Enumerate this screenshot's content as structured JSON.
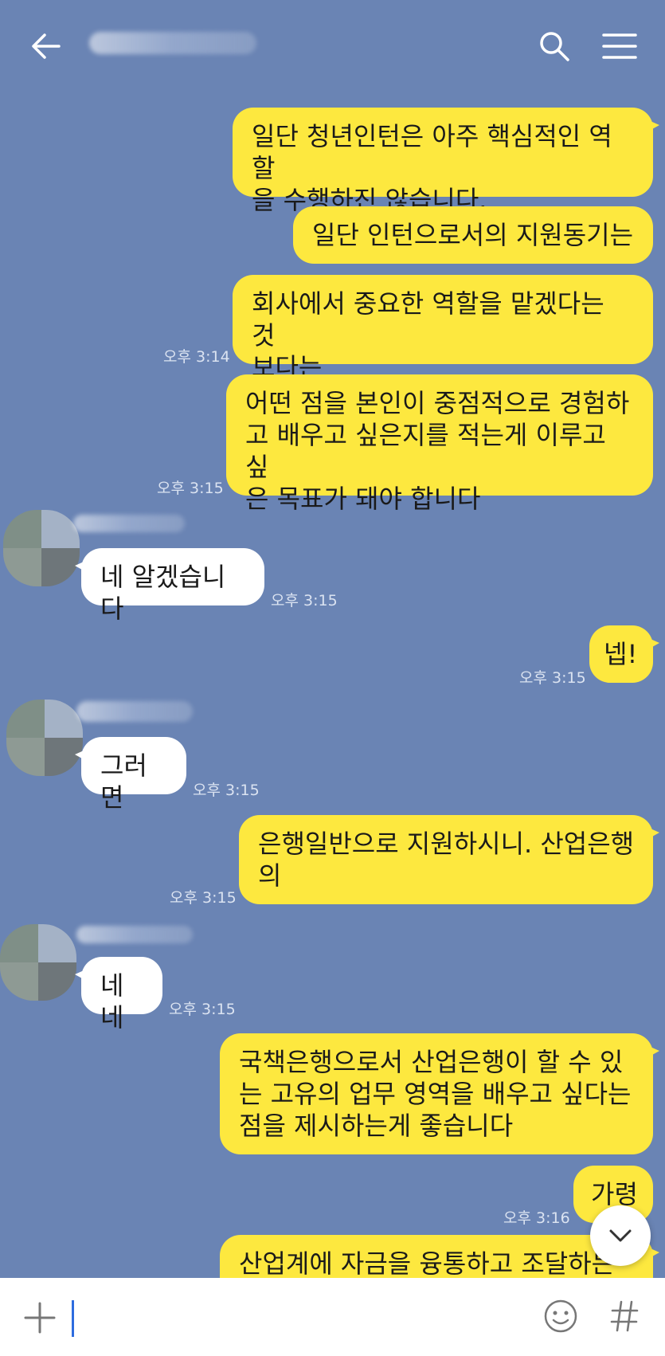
{
  "header": {
    "back_icon": "arrow-left-icon",
    "search_icon": "search-icon",
    "menu_icon": "hamburger-menu-icon"
  },
  "messages": [
    {
      "sender": "me",
      "text": "일단 청년인턴은 아주 핵심적인 역할\n을 수행하진 않습니다.",
      "time": ""
    },
    {
      "sender": "me",
      "text": "일단 인턴으로서의 지원동기는",
      "time": ""
    },
    {
      "sender": "me",
      "text": "회사에서 중요한 역할을 맡겠다는 것\n보다는",
      "time": "오후 3:14"
    },
    {
      "sender": "me",
      "text": "어떤 점을 본인이 중점적으로 경험하\n고 배우고 싶은지를 적는게 이루고 싶\n은 목표가 돼야 합니다",
      "time": "오후 3:15"
    },
    {
      "sender": "other",
      "text": "네 알겠습니다",
      "time": "오후 3:15"
    },
    {
      "sender": "me",
      "text": "넵!",
      "time": "오후 3:15"
    },
    {
      "sender": "other",
      "text": "그러면",
      "time": "오후 3:15"
    },
    {
      "sender": "me",
      "text": "은행일반으로 지원하시니. 산업은행\n의",
      "time": "오후 3:15"
    },
    {
      "sender": "other",
      "text": "네네",
      "time": "오후 3:15"
    },
    {
      "sender": "me",
      "text": "국책은행으로서 산업은행이 할 수 있\n는 고유의 업무 영역을 배우고 싶다는\n점을 제시하는게 좋습니다",
      "time": ""
    },
    {
      "sender": "me",
      "text": "가령",
      "time": "오후 3:16"
    },
    {
      "sender": "me",
      "text": "산업계에 자금을 융통하고 조달하는",
      "time": ""
    }
  ],
  "input": {
    "plus_icon": "plus-icon",
    "emoji_icon": "emoji-icon",
    "hashtag_icon": "hashtag-icon"
  },
  "scroll_down_icon": "chevron-down-icon",
  "colors": {
    "background": "#6a84b4",
    "my_bubble": "#fde83f",
    "other_bubble": "#ffffff"
  }
}
